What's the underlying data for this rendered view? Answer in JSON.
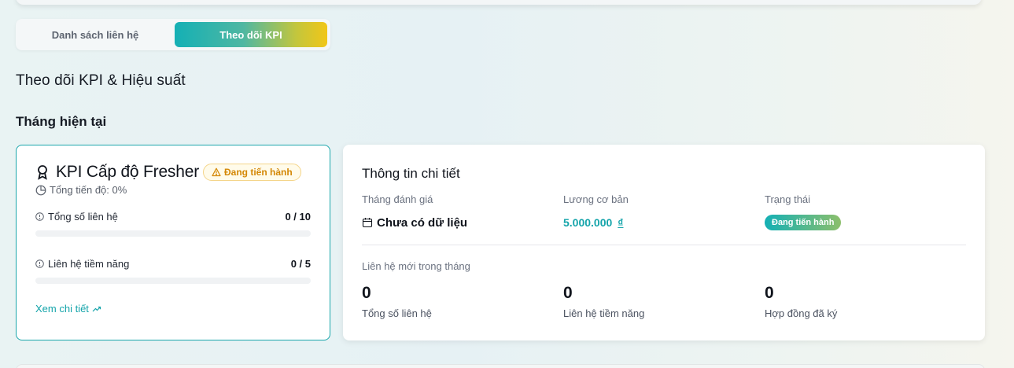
{
  "tabs": [
    {
      "label": "Danh sách liên hệ",
      "active": false
    },
    {
      "label": "Theo dõi KPI",
      "active": true
    }
  ],
  "page_title": "Theo dõi KPI & Hiệu suất",
  "section_title": "Tháng hiện tại",
  "kpi_card": {
    "icon": "award-icon",
    "title": "KPI Cấp độ Fresher",
    "badge": "Đang tiến hành",
    "progress_text": "Tổng tiến độ: 0%",
    "progress_percent": 0,
    "metrics": [
      {
        "label": "Tổng số liên hệ",
        "value": "0 / 10",
        "fill": 0
      },
      {
        "label": "Liên hệ tiềm năng",
        "value": "0 / 5",
        "fill": 0
      }
    ],
    "detail_link": "Xem chi tiết"
  },
  "info_card": {
    "title": "Thông tin chi tiết",
    "eval_month_label": "Tháng đánh giá",
    "eval_month_value": "Chưa có dữ liệu",
    "salary_label": "Lương cơ bản",
    "salary_value": "5.000.000",
    "salary_unit": "₫",
    "status_label": "Trạng thái",
    "status_value": "Đang tiến hành",
    "month_contacts_label": "Liên hệ mới trong tháng",
    "stats": [
      {
        "value": "0",
        "label": "Tổng số liên hệ"
      },
      {
        "value": "0",
        "label": "Liên hệ tiềm năng"
      },
      {
        "value": "0",
        "label": "Hợp đồng đã ký"
      }
    ]
  },
  "colors": {
    "accent": "#14b0b5",
    "warning": "#d48806",
    "gradient_end": "#f1c618"
  }
}
